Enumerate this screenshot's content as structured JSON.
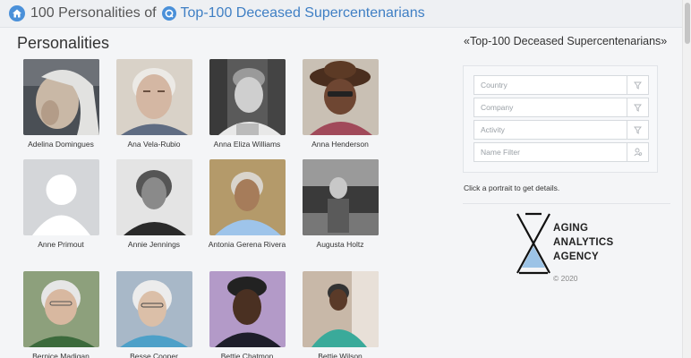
{
  "breadcrumb": {
    "prefix": "100 Personalities of",
    "link": "Top-100 Deceased Supercentenarians"
  },
  "main": {
    "title": "Personalities",
    "people": [
      {
        "name": "Adelina Domingues"
      },
      {
        "name": "Ana Vela-Rubio"
      },
      {
        "name": "Anna Eliza Williams"
      },
      {
        "name": "Anna Henderson"
      },
      {
        "name": "Anne Primout"
      },
      {
        "name": "Annie Jennings"
      },
      {
        "name": "Antonia Gerena Rivera"
      },
      {
        "name": "Augusta Holtz"
      },
      {
        "name": "Bernice Madigan"
      },
      {
        "name": "Besse Cooper"
      },
      {
        "name": "Bettie Chatmon"
      },
      {
        "name": "Bettie Wilson"
      }
    ]
  },
  "sidebar": {
    "title": "«Top-100 Deceased Supercentenarians»",
    "filters": {
      "country_placeholder": "Country",
      "company_placeholder": "Company",
      "activity_placeholder": "Activity",
      "name_placeholder": "Name Filter"
    },
    "hint": "Click a portrait to get details.",
    "logo": {
      "line1": "AGING",
      "line2": "ANALYTICS",
      "line3": "AGENCY"
    },
    "copyright": "© 2020"
  },
  "colors": {
    "link": "#3f7fc4",
    "icon": "#4a90d9",
    "logo_accent": "#9cc3e6"
  }
}
